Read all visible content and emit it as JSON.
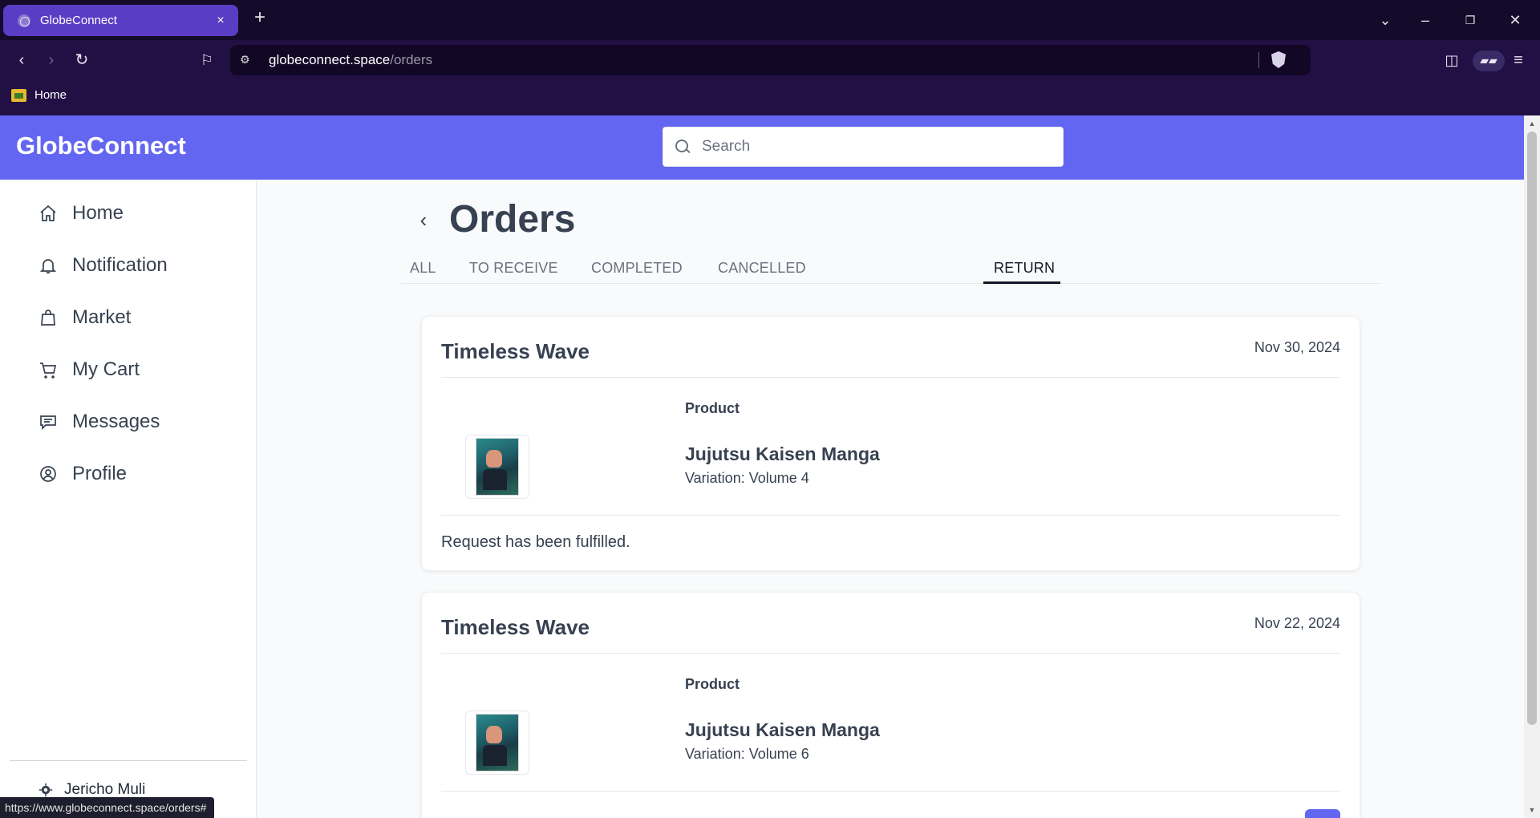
{
  "browser": {
    "tab_title": "GlobeConnect",
    "tab_close": "×",
    "new_tab": "+",
    "url_host": "globeconnect.space",
    "url_path": "/orders",
    "bookmark_home": "Home",
    "status_url": "https://www.globeconnect.space/orders#"
  },
  "header": {
    "brand": "GlobeConnect",
    "search_placeholder": "Search"
  },
  "sidebar": {
    "items": [
      {
        "label": "Home",
        "icon": "home-icon"
      },
      {
        "label": "Notification",
        "icon": "bell-icon"
      },
      {
        "label": "Market",
        "icon": "shopping-bag-icon"
      },
      {
        "label": "My Cart",
        "icon": "cart-icon"
      },
      {
        "label": "Messages",
        "icon": "message-icon"
      },
      {
        "label": "Profile",
        "icon": "user-circle-icon"
      }
    ],
    "user_name": "Jericho Muli"
  },
  "page": {
    "title": "Orders",
    "tabs": [
      "ALL",
      "TO RECEIVE",
      "COMPLETED",
      "CANCELLED",
      "RETURN"
    ],
    "active_tab": "RETURN"
  },
  "orders": [
    {
      "shop": "Timeless Wave",
      "date": "Nov 30, 2024",
      "product_label": "Product",
      "product_name": "Jujutsu Kaisen Manga",
      "variation": "Variation: Volume 4",
      "note": "Request has been fulfilled."
    },
    {
      "shop": "Timeless Wave",
      "date": "Nov 22, 2024",
      "product_label": "Product",
      "product_name": "Jujutsu Kaisen Manga",
      "variation": "Variation: Volume 6",
      "note": "",
      "action": ""
    }
  ],
  "colors": {
    "brand": "#6366f1",
    "browser_dark": "#140a2a",
    "browser_toolbar": "#221045",
    "tab_active": "#5b3cc4"
  }
}
